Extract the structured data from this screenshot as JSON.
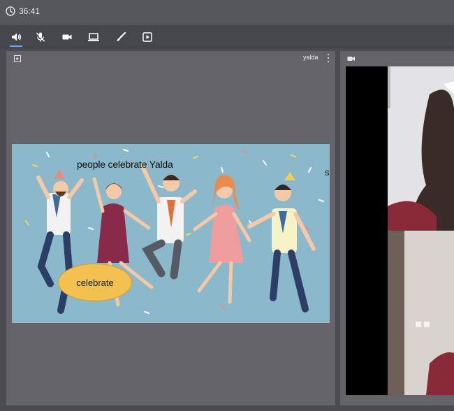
{
  "timer": {
    "value": "36:41"
  },
  "toolbar": {
    "active": "speaker"
  },
  "main_panel": {
    "participant_name": "yalda"
  },
  "slide": {
    "title": "people celebrate Yalda",
    "bubble_label": "celebrate",
    "edge_text": "s"
  },
  "colors": {
    "accent": "#5aa9ff",
    "slide_bg": "#8cb8cc",
    "bubble": "#f2c14f",
    "panel": "#636369"
  }
}
